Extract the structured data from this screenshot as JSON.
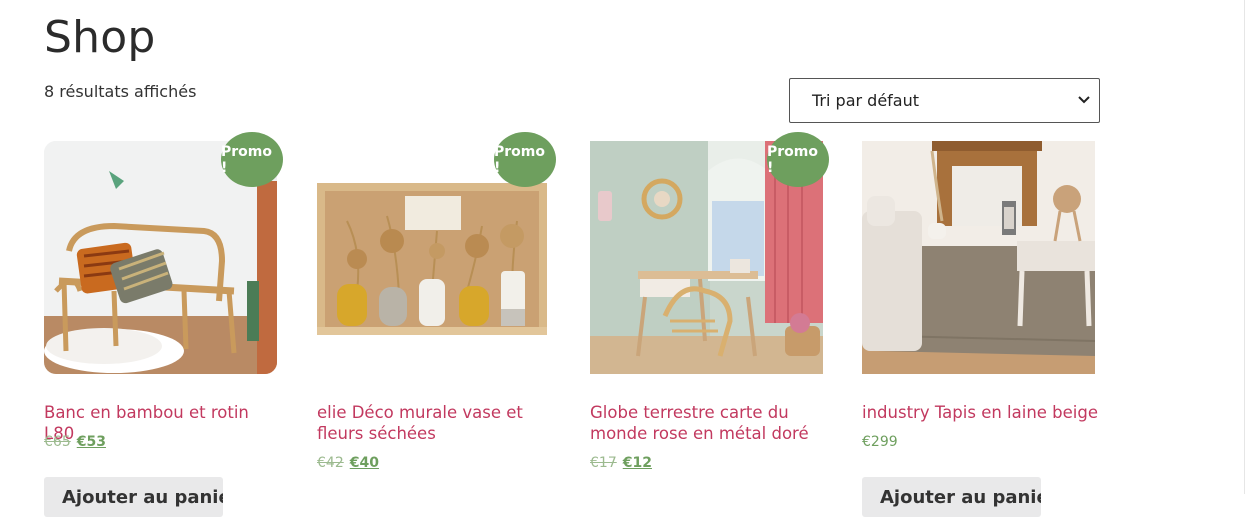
{
  "page": {
    "title": "Shop",
    "result_count": "8 résultats affichés"
  },
  "ordering": {
    "selected": "Tri par défaut"
  },
  "colors": {
    "title": "#c2395f",
    "badge": "#6e9f5e",
    "price": "#6e9f5e"
  },
  "products": [
    {
      "title": "Banc en bambou et rotin L80",
      "badge": "Promo !",
      "old_price": "€65",
      "price": "€53",
      "button": "Ajouter au panier"
    },
    {
      "title": "elie Déco murale vase et fleurs séchées",
      "badge": "Promo !",
      "old_price": "€42",
      "price": "€40"
    },
    {
      "title": "Globe terrestre carte du monde rose en métal doré",
      "badge": "Promo !",
      "old_price": "€17",
      "price": "€12"
    },
    {
      "title": "industry Tapis en laine beige",
      "price": "€299",
      "button": "Ajouter au panier"
    }
  ]
}
